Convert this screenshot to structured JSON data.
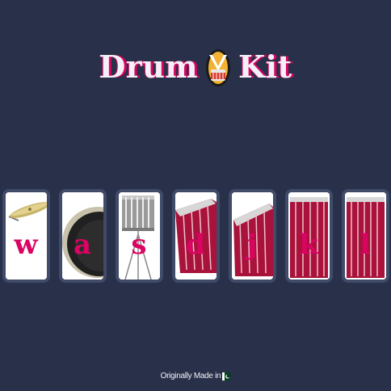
{
  "app": {
    "title_part1": "Drum",
    "title_part2": "Kit",
    "logo_icon": "drum-logo-icon"
  },
  "keys": [
    {
      "letter": "w",
      "instrument_icon": "crash-cymbal-icon"
    },
    {
      "letter": "a",
      "instrument_icon": "kick-drum-icon"
    },
    {
      "letter": "s",
      "instrument_icon": "snare-drum-icon"
    },
    {
      "letter": "d",
      "instrument_icon": "tom-drum-1-icon"
    },
    {
      "letter": "j",
      "instrument_icon": "tom-drum-2-icon"
    },
    {
      "letter": "k",
      "instrument_icon": "tom-drum-3-icon"
    },
    {
      "letter": "l",
      "instrument_icon": "tom-drum-4-icon"
    }
  ],
  "footer": {
    "text": "Originally Made in",
    "flag_icon": "pakistan-flag-icon"
  },
  "colors": {
    "background": "#283149",
    "key_border": "#404b69",
    "accent": "#da0463",
    "text": "#f3f1f7"
  }
}
